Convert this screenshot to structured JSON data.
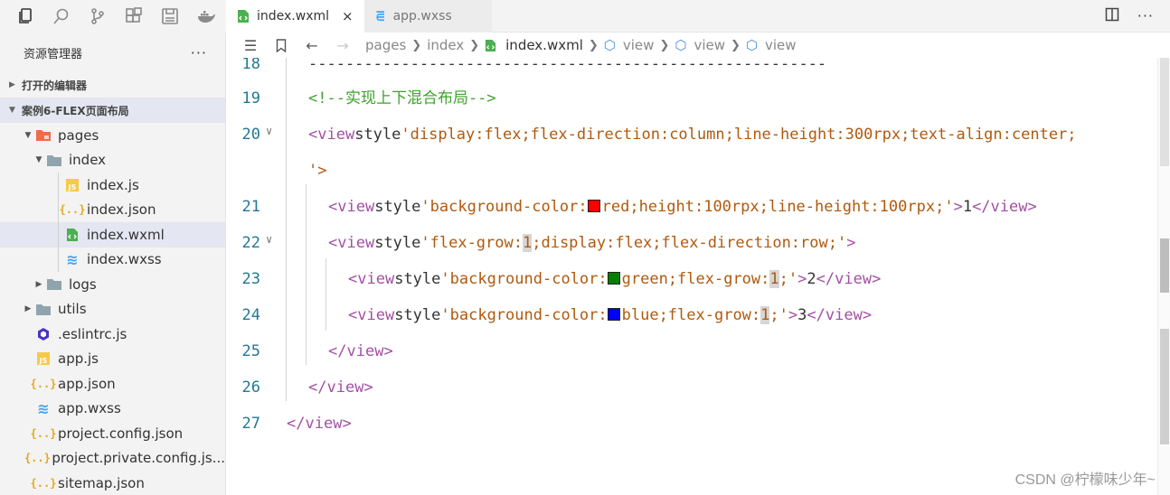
{
  "activity_bar": {
    "icons": [
      "files-icon",
      "search-icon",
      "source-control-icon",
      "extensions-icon",
      "save-icon",
      "docker-icon"
    ]
  },
  "sidebar": {
    "title": "资源管理器",
    "more": "···",
    "open_editors": "打开的编辑器",
    "project": "案例6-FLEX页面布局",
    "tree": [
      {
        "label": "pages",
        "type": "folder-pages",
        "expanded": true
      },
      {
        "label": "index",
        "type": "folder",
        "expanded": true
      },
      {
        "label": "index.js",
        "type": "js"
      },
      {
        "label": "index.json",
        "type": "json"
      },
      {
        "label": "index.wxml",
        "type": "wxml",
        "selected": true
      },
      {
        "label": "index.wxss",
        "type": "wxss"
      },
      {
        "label": "logs",
        "type": "folder",
        "expanded": false
      },
      {
        "label": "utils",
        "type": "folder",
        "expanded": false
      },
      {
        "label": ".eslintrc.js",
        "type": "eslint"
      },
      {
        "label": "app.js",
        "type": "js"
      },
      {
        "label": "app.json",
        "type": "json"
      },
      {
        "label": "app.wxss",
        "type": "wxss"
      },
      {
        "label": "project.config.json",
        "type": "json"
      },
      {
        "label": "project.private.config.js...",
        "type": "json"
      },
      {
        "label": "sitemap.json",
        "type": "json"
      }
    ]
  },
  "tabs": [
    {
      "label": "index.wxml",
      "close": "×",
      "active": true
    },
    {
      "label": "app.wxss",
      "active": false
    }
  ],
  "breadcrumb": [
    "pages",
    "index",
    "index.wxml",
    "view",
    "view",
    "view"
  ],
  "editor": {
    "lines": [
      {
        "n": "18",
        "text": "--------------------------------------------------------"
      },
      {
        "n": "19",
        "text": "<!--实现上下混合布局-->"
      },
      {
        "n": "20",
        "text": "<view style='display:flex;flex-direction:column;line-height:300rpx;text-align:center;"
      },
      {
        "n": "",
        "text": "'>"
      },
      {
        "n": "21",
        "text": "<view style='background-color:red;height:100rpx;line-height:100rpx;'>1</view>"
      },
      {
        "n": "22",
        "text": "<view style='flex-grow:1;display:flex;flex-direction:row;'>"
      },
      {
        "n": "23",
        "text": "<view style='background-color:green;flex-grow:1;'>2</view>"
      },
      {
        "n": "24",
        "text": "<view style='background-color:blue;flex-grow:1;'>3</view>"
      },
      {
        "n": "25",
        "text": "</view>"
      },
      {
        "n": "26",
        "text": "</view>"
      },
      {
        "n": "27",
        "text": "</view>"
      }
    ],
    "swatch_colors": {
      "red": "#ff0000",
      "green": "#008000",
      "blue": "#0000ff"
    }
  },
  "watermark": "CSDN @柠檬味少年~"
}
